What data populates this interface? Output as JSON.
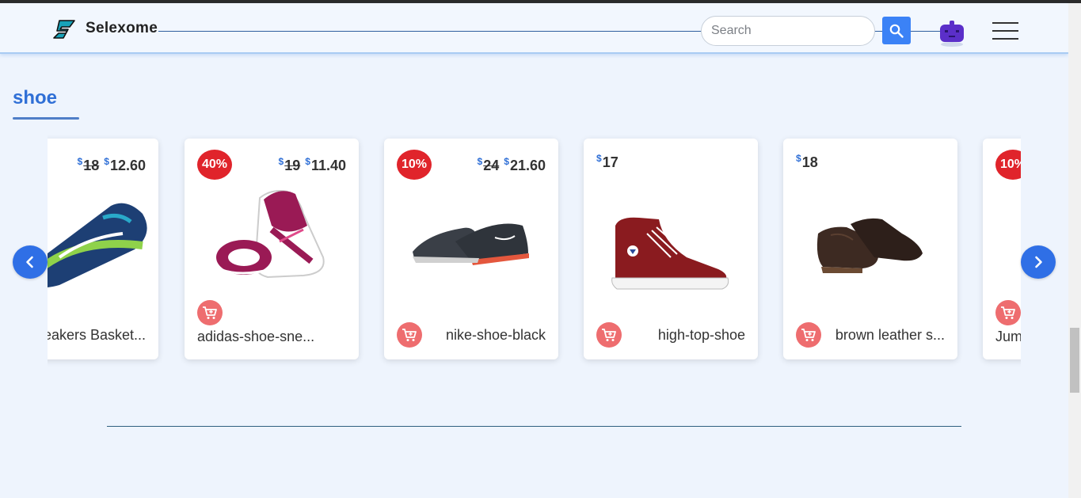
{
  "header": {
    "brand": "Selexome",
    "search_placeholder": "Search",
    "colors": {
      "accent": "#3b82f6",
      "bot": "#5b2fc9"
    }
  },
  "section": {
    "title": "shoe"
  },
  "products": [
    {
      "name": "eakers Basket...",
      "old_price": "18",
      "price": "12.60",
      "discount": "",
      "currency": "$"
    },
    {
      "name": "adidas-shoe-sne...",
      "old_price": "19",
      "price": "11.40",
      "discount": "40%",
      "currency": "$"
    },
    {
      "name": "nike-shoe-black",
      "old_price": "24",
      "price": "21.60",
      "discount": "10%",
      "currency": "$"
    },
    {
      "name": "high-top-shoe",
      "old_price": "",
      "price": "17",
      "discount": "",
      "currency": "$"
    },
    {
      "name": "brown leather s...",
      "old_price": "",
      "price": "18",
      "discount": "",
      "currency": "$"
    },
    {
      "name": "Jum",
      "old_price": "",
      "price": "",
      "discount": "10%",
      "currency": "$"
    }
  ],
  "icons": {
    "logo": "lightning-s-logo",
    "search": "search-icon",
    "avatar": "robot-icon",
    "menu": "hamburger-icon",
    "cart": "add-to-cart-icon",
    "prev": "chevron-left-icon",
    "next": "chevron-right-icon"
  }
}
